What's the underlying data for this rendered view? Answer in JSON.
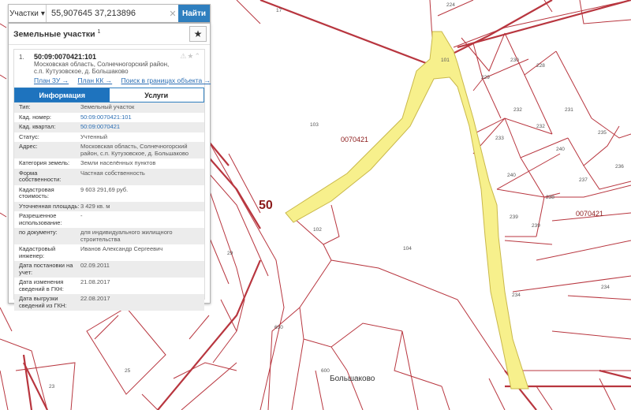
{
  "search": {
    "type_label": "Участки",
    "value": "55,907645 37,213896",
    "button_label": "Найти"
  },
  "panel": {
    "title": "Земельные участки",
    "count": "1",
    "item": {
      "index": "1.",
      "cadastral_number": "50:09:0070421:101",
      "address": "Московская область, Солнечногорский район, с.п. Кутузовское, д. Большаково",
      "links": [
        "План ЗУ →",
        "План КК →",
        "Поиск в границах объекта →"
      ]
    },
    "tabs": [
      {
        "label": "Информация",
        "active": true
      },
      {
        "label": "Услуги",
        "active": false
      }
    ],
    "rows": [
      {
        "key": "Тип:",
        "value": "Земельный участок"
      },
      {
        "key": "Кад. номер:",
        "value": "50:09:0070421:101",
        "link": true
      },
      {
        "key": "Кад. квартал:",
        "value": "50:09:0070421",
        "link": true
      },
      {
        "key": "Статус:",
        "value": "Учтенный"
      },
      {
        "key": "Адрес:",
        "value": "Московская область, Солнечногорский район, с.п. Кутузовское, д. Большаково"
      },
      {
        "key": "Категория земель:",
        "value": "Земли населённых пунктов"
      },
      {
        "key": "Форма собственности:",
        "value": "Частная собственность"
      },
      {
        "key": "Кадастровая стоимость:",
        "value": "9 603 291,69 руб."
      },
      {
        "key": "Уточненная площадь:",
        "value": "3 429 кв. м"
      },
      {
        "key": "Разрешенное использование:",
        "value": "-"
      },
      {
        "key": "по документу:",
        "value": "для индивидуального жилищного строительства"
      },
      {
        "key": "Кадастровый инженер:",
        "value": "Иванов Александр Сергеевич"
      },
      {
        "key": "Дата постановки на учет:",
        "value": "02.09.2011"
      },
      {
        "key": "Дата изменения сведений в ГКН:",
        "value": "21.08.2017"
      },
      {
        "key": "Дата выгрузки сведений из ГКН:",
        "value": "22.08.2017"
      }
    ]
  },
  "map": {
    "colors": {
      "boundary": "#b8363f",
      "selected_fill": "#f7f08c",
      "selected_stroke": "#c9b84a",
      "background": "#ffffff"
    },
    "region_number": "50",
    "quarter_labels": [
      "0070421",
      "0070421"
    ],
    "place_name": "Большаково",
    "parcel_numbers": [
      "17",
      "224",
      "101",
      "230",
      "229",
      "228",
      "103",
      "232",
      "231",
      "232",
      "233",
      "240",
      "235",
      "236",
      "240",
      "237",
      "238",
      "239",
      "239",
      "102",
      "104",
      "29",
      "234",
      "234",
      "650",
      "25",
      "600",
      "23"
    ]
  }
}
